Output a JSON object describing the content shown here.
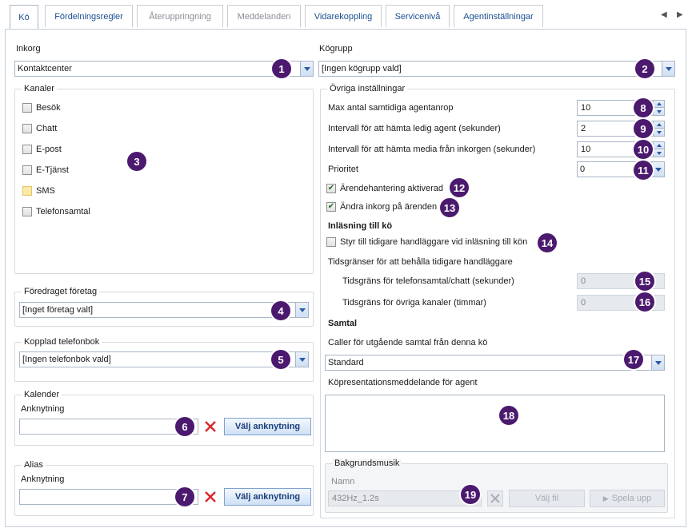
{
  "tabs": [
    {
      "label": "Kö"
    },
    {
      "label": "Fördelningsregler"
    },
    {
      "label": "Återuppringning"
    },
    {
      "label": "Meddelanden"
    },
    {
      "label": "Vidarekoppling"
    },
    {
      "label": "Servicenivå"
    },
    {
      "label": "Agentinställningar"
    }
  ],
  "inkorg": {
    "label": "Inkorg",
    "value": "Kontaktcenter"
  },
  "kogrupp": {
    "label": "Kögrupp",
    "value": "[Ingen kögrupp vald]"
  },
  "kanaler": {
    "title": "Kanaler",
    "items": [
      {
        "label": "Besök"
      },
      {
        "label": "Chatt"
      },
      {
        "label": "E-post"
      },
      {
        "label": "E-Tjänst"
      },
      {
        "label": "SMS"
      },
      {
        "label": "Telefonsamtal"
      }
    ]
  },
  "foretag": {
    "title": "Föredraget företag",
    "value": "[Inget företag valt]"
  },
  "telefonbok": {
    "title": "Kopplad telefonbok",
    "value": "[Ingen telefonbok vald]"
  },
  "kalender": {
    "title": "Kalender",
    "field_label": "Anknytning",
    "value": "",
    "button": "Välj anknytning"
  },
  "alias": {
    "title": "Alias",
    "field_label": "Anknytning",
    "value": "",
    "button": "Välj anknytning"
  },
  "ovriga": {
    "title": "Övriga inställningar",
    "max_agentanrop": {
      "label": "Max antal samtidiga agentanrop",
      "value": "10"
    },
    "intervall_agent": {
      "label": "Intervall för att hämta ledig agent (sekunder)",
      "value": "2"
    },
    "intervall_media": {
      "label": "Intervall för att hämta media från inkorgen (sekunder)",
      "value": "10"
    },
    "prioritet": {
      "label": "Prioritet",
      "value": "0"
    },
    "arendehantering": {
      "label": "Ärendehantering aktiverad",
      "checked": true
    },
    "andra_inkorg": {
      "label": "Ändra inkorg på ärenden",
      "checked": true
    },
    "inlasning_heading": "Inläsning till kö",
    "styr_till": {
      "label": "Styr till tidigare handläggare vid inläsning till kön",
      "checked": false
    },
    "tidsgranser_label": "Tidsgränser för att behålla tidigare handläggare",
    "tidsgrans_telefon": {
      "label": "Tidsgräns för telefonsamtal/chatt (sekunder)",
      "value": "0"
    },
    "tidsgrans_ovriga": {
      "label": "Tidsgräns för övriga kanaler (timmar)",
      "value": "0"
    },
    "samtal_heading": "Samtal",
    "caller_label": "Caller för utgående samtal från denna kö",
    "caller_value": "Standard",
    "kopresentation_label": "Köpresentationsmeddelande för agent",
    "kopresentation_value": ""
  },
  "bakgrundsmusik": {
    "title": "Bakgrundsmusik",
    "namn_label": "Namn",
    "namn_value": "432Hz_1.2s",
    "valj_fil": "Välj fil",
    "spela_upp": "Spela upp"
  },
  "badges": [
    "1",
    "2",
    "3",
    "4",
    "5",
    "6",
    "7",
    "8",
    "9",
    "10",
    "11",
    "12",
    "13",
    "14",
    "15",
    "16",
    "17",
    "18",
    "19"
  ],
  "colors": {
    "badge": "#4b1a6e",
    "tab_text": "#1b4f91",
    "delete_x": "#d9262b"
  }
}
